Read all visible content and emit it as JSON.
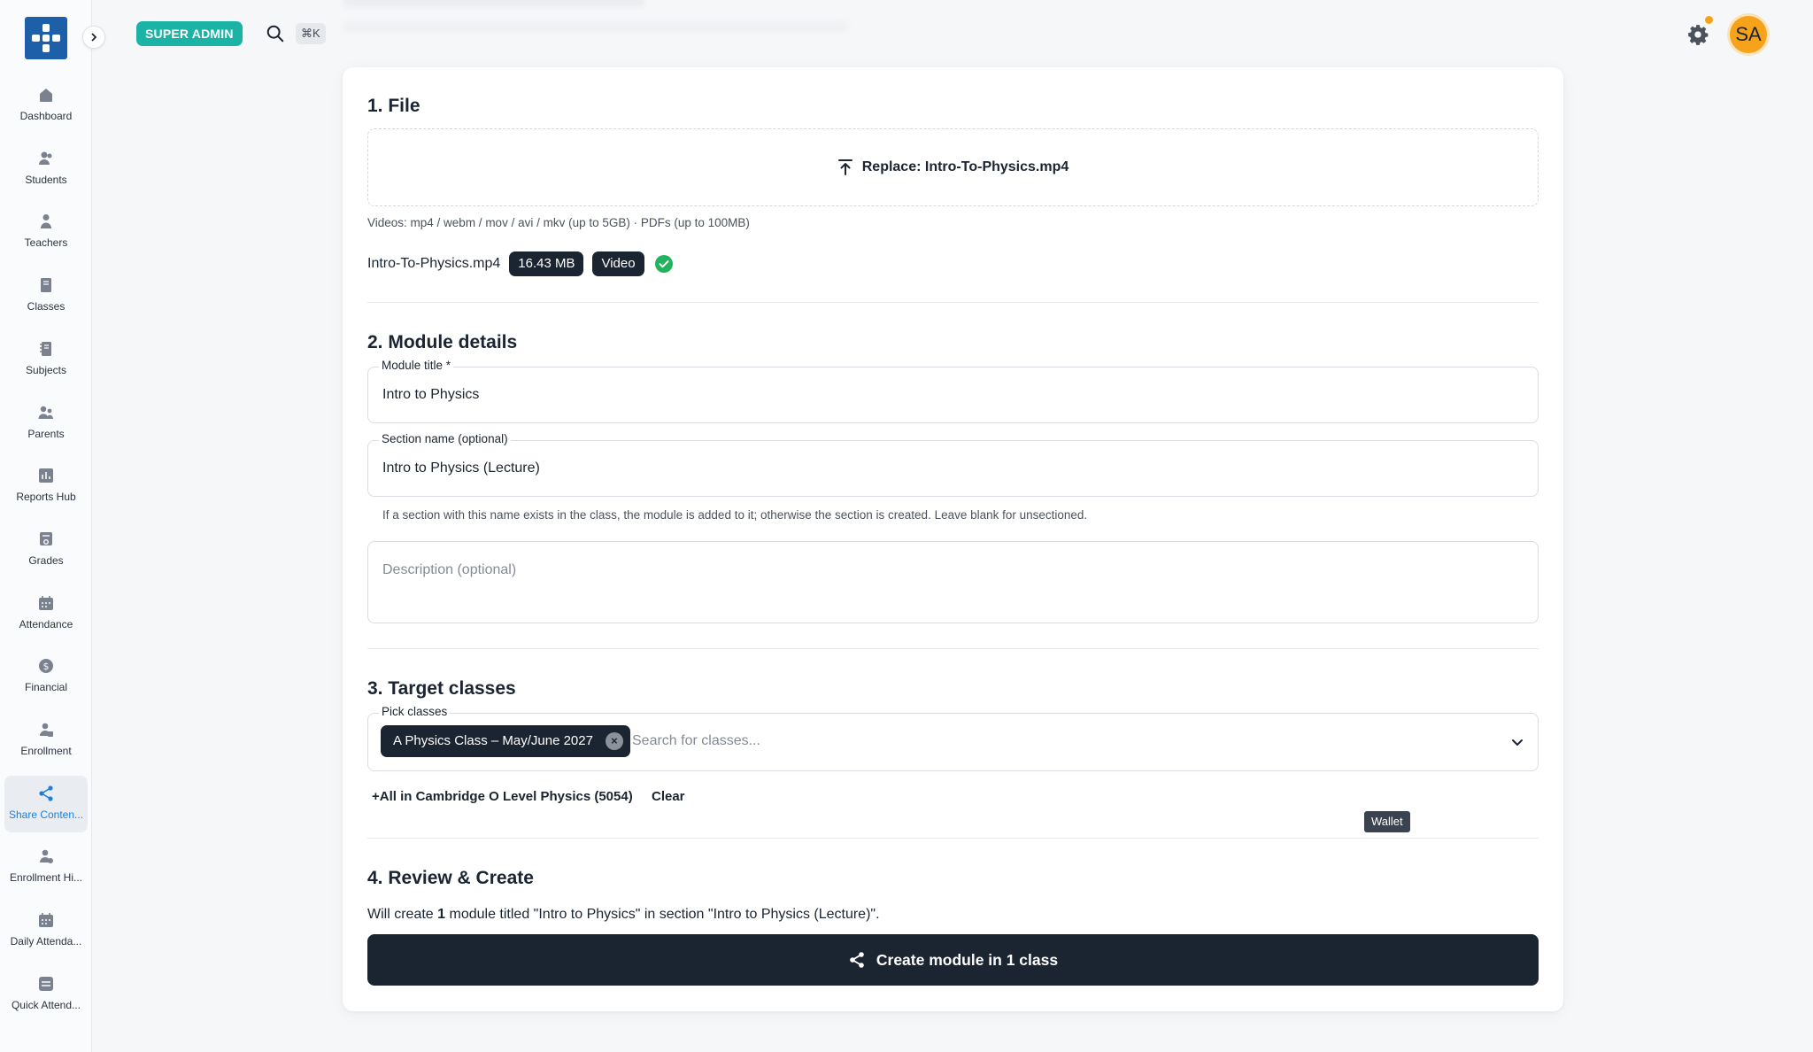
{
  "sidebar": {
    "items": [
      {
        "label": "Dashboard",
        "icon": "home-icon"
      },
      {
        "label": "Students",
        "icon": "students-icon"
      },
      {
        "label": "Teachers",
        "icon": "teacher-icon"
      },
      {
        "label": "Classes",
        "icon": "classes-icon"
      },
      {
        "label": "Subjects",
        "icon": "subjects-icon"
      },
      {
        "label": "Parents",
        "icon": "parents-icon"
      },
      {
        "label": "Reports Hub",
        "icon": "reports-icon"
      },
      {
        "label": "Grades",
        "icon": "grades-icon"
      },
      {
        "label": "Attendance",
        "icon": "calendar-icon"
      },
      {
        "label": "Financial",
        "icon": "dollar-icon"
      },
      {
        "label": "Enrollment",
        "icon": "enrollment-icon"
      },
      {
        "label": "Share Conten...",
        "icon": "share-icon",
        "active": true
      },
      {
        "label": "Enrollment Hi...",
        "icon": "enrollment-history-icon"
      },
      {
        "label": "Daily Attenda...",
        "icon": "calendar-icon"
      },
      {
        "label": "Quick Attend...",
        "icon": "quick-attendance-icon"
      }
    ]
  },
  "topbar": {
    "role_badge": "SUPER ADMIN",
    "shortcut": "⌘K",
    "avatar_initials": "SA"
  },
  "file_section": {
    "title": "1. File",
    "replace_label": "Replace: Intro-To-Physics.mp4",
    "hint": "Videos: mp4 / webm / mov / avi / mkv (up to 5GB) · PDFs (up to 100MB)",
    "file_name": "Intro-To-Physics.mp4",
    "file_size": "16.43 MB",
    "file_type": "Video"
  },
  "details_section": {
    "title": "2. Module details",
    "module_title_label": "Module title *",
    "module_title_value": "Intro to Physics",
    "section_name_label": "Section name (optional)",
    "section_name_value": "Intro to Physics (Lecture)",
    "section_hint": "If a section with this name exists in the class, the module is added to it; otherwise the section is created. Leave blank for unsectioned.",
    "description_placeholder": "Description (optional)"
  },
  "targets_section": {
    "title": "3. Target classes",
    "pick_label": "Pick classes",
    "selected_class": "A Physics Class – May/June 2027",
    "search_placeholder": "Search for classes...",
    "add_all_label": "+All in Cambridge O Level Physics (5054)",
    "clear_label": "Clear"
  },
  "tooltip": "Wallet",
  "review_section": {
    "title": "4. Review & Create",
    "summary_prefix": "Will create",
    "summary_count": "1",
    "summary_suffix": "module titled \"Intro to Physics\" in section \"Intro to Physics (Lecture)\".",
    "create_label": "Create module in 1 class"
  },
  "colors": {
    "primary_dark": "#1b2431",
    "accent_blue": "#1e7fd8",
    "badge_teal": "#1ab3a5",
    "success_green": "#22b35e",
    "avatar_orange": "#f7a21b"
  }
}
